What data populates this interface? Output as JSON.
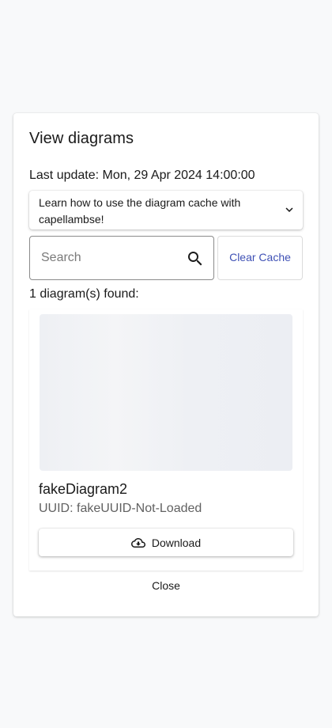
{
  "dialog": {
    "title": "View diagrams",
    "last_update": "Last update: Mon, 29 Apr 2024 14:00:00",
    "accordion": {
      "label": "Learn how to use the diagram cache with capellambse!",
      "icon": "chevron-down-icon"
    },
    "search": {
      "placeholder": "Search",
      "value": "",
      "icon": "search-icon"
    },
    "clear_cache_label": "Clear Cache",
    "found_text": "1 diagram(s) found:",
    "diagrams": [
      {
        "name": "fakeDiagram2",
        "uuid": "UUID: fakeUUID-Not-Loaded",
        "download_label": "Download",
        "download_icon": "cloud-download-icon"
      }
    ],
    "close_label": "Close"
  },
  "colors": {
    "accent": "#3f51b5",
    "background": "#f8f9fa",
    "surface": "#ffffff",
    "text": "#1a1a1a",
    "muted_text": "#616161",
    "preview_placeholder": "#eef0f4"
  }
}
